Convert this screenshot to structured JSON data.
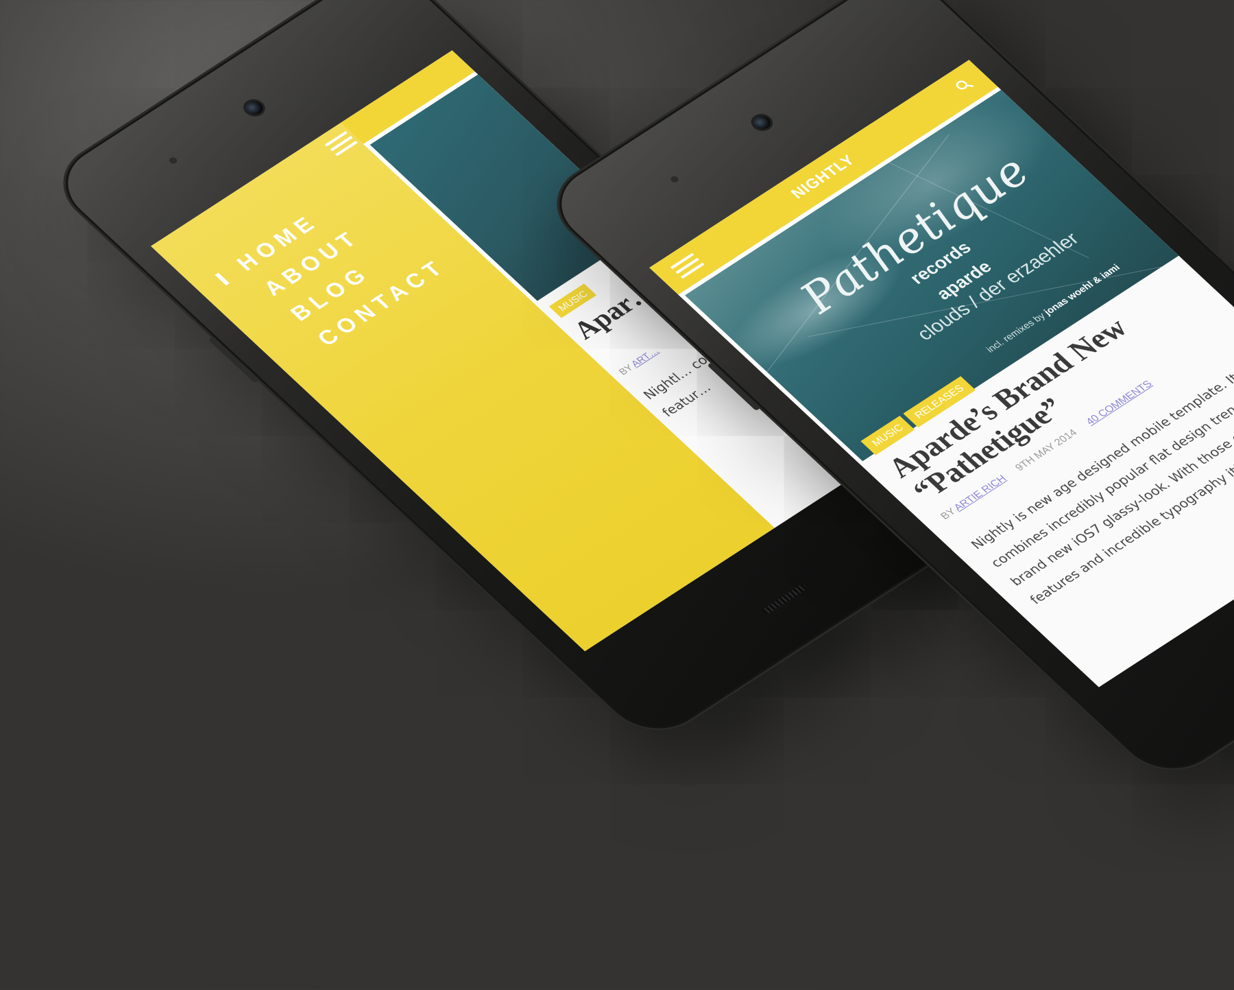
{
  "menu_screen": {
    "menu_items": [
      "HOME",
      "ABOUT",
      "BLOG",
      "CONTACT"
    ],
    "peek_tag": "MUSIC",
    "peek_title": "Apar… “Pa…",
    "peek_by_prefix": "BY",
    "peek_author": "ART…",
    "peek_body": "Nightl… combi… brand… featur…"
  },
  "article_screen": {
    "logo": "NIGHTLY",
    "hero": {
      "script": "Pathetique",
      "records": "records",
      "artist": "aparde",
      "tracks": "clouds / der erzaehler",
      "credits_prefix": "incl. remixes by",
      "credits_names": "jonas woehl & iami"
    },
    "tags": [
      "MUSIC",
      "RELEASES"
    ],
    "title": "Aparde’s Brand New “Pathetigue”",
    "by_prefix": "BY",
    "author": "ARTIE RICH",
    "date": "9TH MAY 2014",
    "comments": "40 COMMENTS",
    "body": "Nightly is new age designed mobile template. It combines incredibly popular flat design trend and brand new iOS7 glassy-look. With those design features and incredible typography it’s great"
  },
  "colors": {
    "accent": "#f2d638",
    "link": "#8c86d8",
    "background": "#4b4a48"
  },
  "icons": {
    "menu": "hamburger-icon",
    "search": "search-icon"
  }
}
